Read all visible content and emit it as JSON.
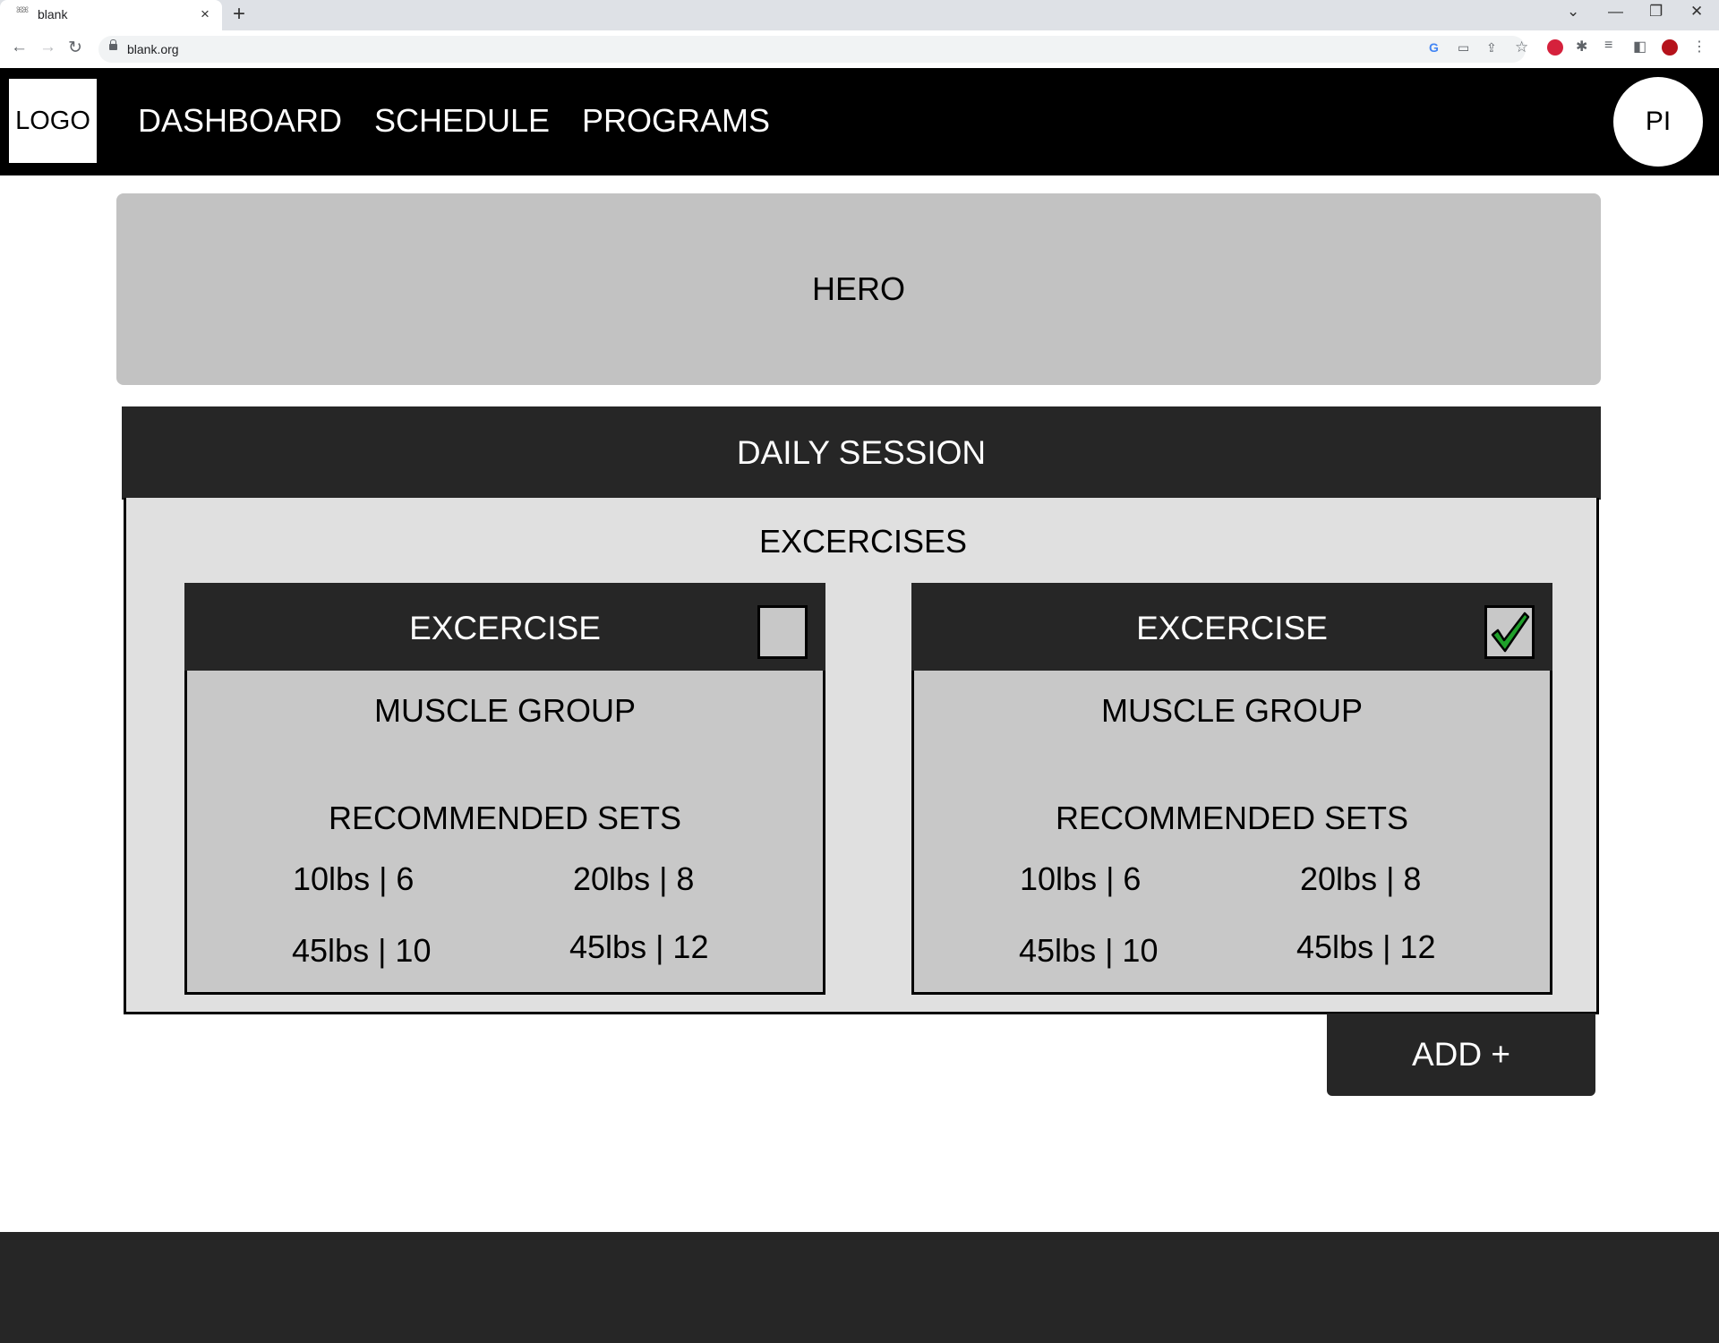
{
  "browser": {
    "tab_title": "blank",
    "tab_close": "×",
    "new_tab": "+",
    "url": "blank.org",
    "favicon_text": "ꕤꕤ",
    "window_controls": {
      "chevron": "⌄",
      "minimize": "—",
      "restore": "❐",
      "close": "✕"
    },
    "nav": {
      "back": "←",
      "forward": "→",
      "reload": "↻"
    },
    "omnibox_icons": {
      "google": "G",
      "card": "▭",
      "share": "⇪",
      "bookmark": "☆"
    },
    "extensions": {
      "abp_color": "#d5213c",
      "puzzle": "✱",
      "media": "≡",
      "sidepanel": "◧",
      "profile_color": "#b5121b",
      "menu": "⋮"
    }
  },
  "site": {
    "logo": "LOGO",
    "nav": [
      "DASHBOARD",
      "SCHEDULE",
      "PROGRAMS"
    ],
    "profile_initials": "PI"
  },
  "hero": {
    "label": "HERO"
  },
  "session": {
    "title": "DAILY SESSION",
    "exercises_title": "EXCERCISES",
    "cards": [
      {
        "title": "EXCERCISE",
        "checked": false,
        "muscle_group": "MUSCLE GROUP",
        "recommended_label": "RECOMMENDED SETS",
        "sets": [
          "10lbs | 6",
          "20lbs | 8",
          "45lbs | 10",
          "45lbs | 12"
        ]
      },
      {
        "title": "EXCERCISE",
        "checked": true,
        "muscle_group": "MUSCLE GROUP",
        "recommended_label": "RECOMMENDED SETS",
        "sets": [
          "10lbs | 6",
          "20lbs | 8",
          "45lbs | 10",
          "45lbs | 12"
        ]
      }
    ],
    "add_button": "ADD +",
    "check_color": "#1fa02a"
  }
}
